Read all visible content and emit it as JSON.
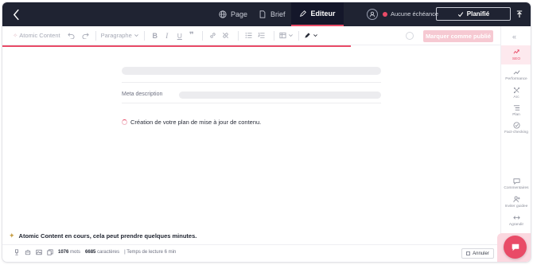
{
  "topbar": {
    "tabs": [
      {
        "label": "Page",
        "icon": "globe-icon"
      },
      {
        "label": "Brief",
        "icon": "document-icon"
      },
      {
        "label": "Editeur",
        "icon": "pencil-icon",
        "active": true
      }
    ],
    "due_label": "Aucune échéance",
    "plan_label": "Planifié",
    "accent": "#e94b67",
    "bg": "#1f2332"
  },
  "toolbar": {
    "atomic_label": "Atomic Content",
    "paragraph_label": "Paragraphe",
    "mark_published_label": "Marquer comme publié"
  },
  "sidebar": {
    "items": [
      {
        "label": "SEO",
        "icon": "seo-icon",
        "active": true
      },
      {
        "label": "Performance",
        "icon": "chart-icon"
      },
      {
        "label": "Arc",
        "icon": "arc-icon"
      },
      {
        "label": "Plan",
        "icon": "plan-icon"
      },
      {
        "label": "Fact-checking",
        "icon": "check-icon"
      },
      {
        "label": "Commentaires",
        "icon": "comment-icon"
      },
      {
        "label": "Inviter guidee",
        "icon": "user-plus-icon"
      },
      {
        "label": "Agrandir",
        "icon": "expand-icon"
      }
    ]
  },
  "editor": {
    "meta_label": "Meta description",
    "creating_text": "Création de votre plan de mise à jour de contenu."
  },
  "footer": {
    "notice": "Atomic Content en cours, cela peut prendre quelques minutes.",
    "words_count": "1076",
    "words_label": "mots",
    "chars_count": "6685",
    "chars_label": "caractères",
    "reading_time": "| Temps de lecture 6 min",
    "cancel_label": "Annuler"
  }
}
